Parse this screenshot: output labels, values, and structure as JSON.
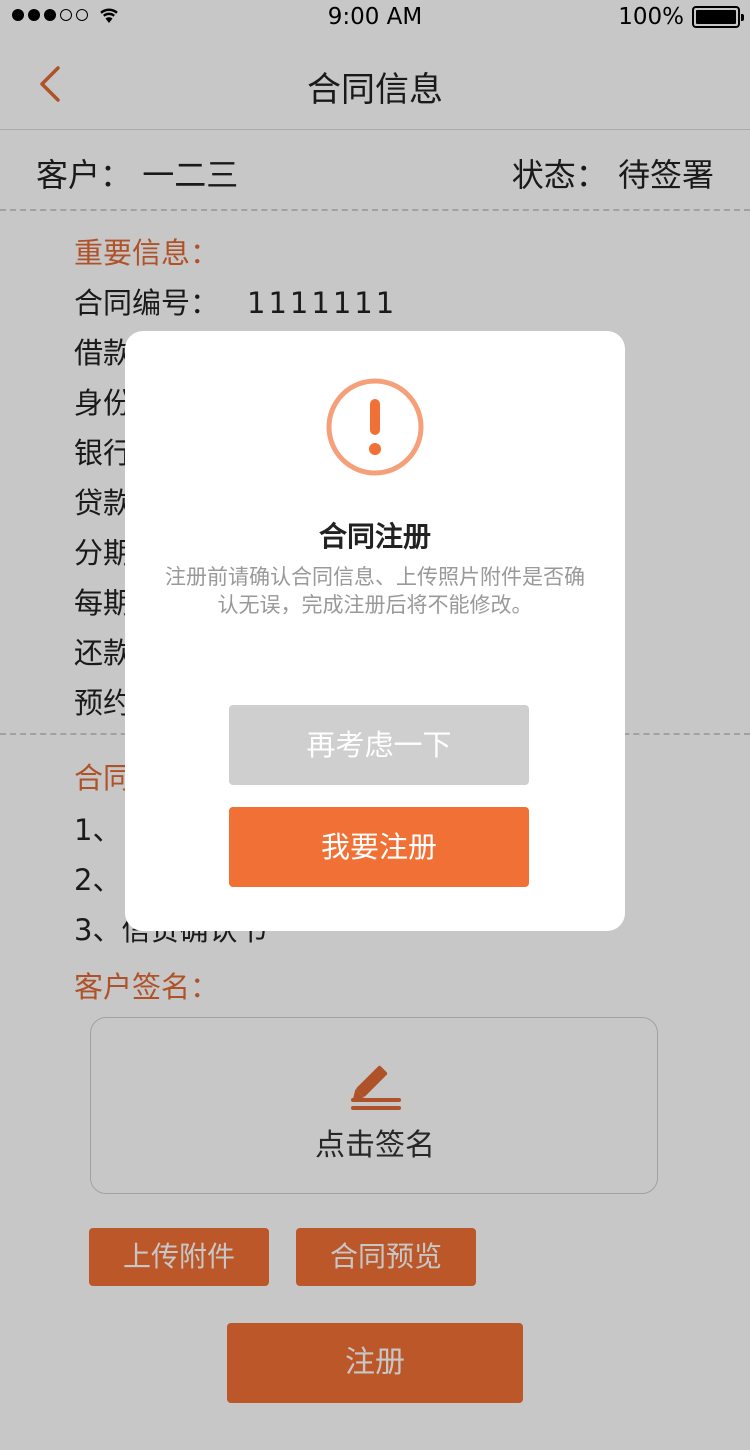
{
  "status_bar": {
    "time": "9:00 AM",
    "battery_percent": "100%",
    "battery_level": 1.0
  },
  "nav": {
    "title": "合同信息",
    "back_icon": "chevron-left-icon"
  },
  "header": {
    "customer_label": "客户：",
    "customer_name": "一二三",
    "status_label": "状态：",
    "status_value": "待签署"
  },
  "important_info": {
    "title": "重要信息：",
    "lines": [
      {
        "label": "合同编号：",
        "value": "1111111"
      },
      {
        "label": "借款",
        "value": ""
      },
      {
        "label": "身份",
        "value": ""
      },
      {
        "label": "银行",
        "value": ""
      },
      {
        "label": "贷款",
        "value": ""
      },
      {
        "label": "分期",
        "value": ""
      },
      {
        "label": "每期",
        "value": ""
      },
      {
        "label": "还款",
        "value": ""
      },
      {
        "label": "预约",
        "value": ""
      }
    ]
  },
  "contract_section": {
    "title": "合同",
    "items": [
      "1、",
      "2、",
      "3、信贷确认书"
    ]
  },
  "signature": {
    "title": "客户签名：",
    "button_label": "点击签名",
    "icon": "pen-icon"
  },
  "actions": {
    "upload_label": "上传附件",
    "preview_label": "合同预览",
    "register_label": "注册"
  },
  "modal": {
    "icon": "alert-icon",
    "title": "合同注册",
    "message": "注册前请确认合同信息、上传照片附件是否确认无误，完成注册后将不能修改。",
    "cancel_label": "再考虑一下",
    "confirm_label": "我要注册"
  },
  "colors": {
    "accent": "#f07035",
    "accent_text": "#e06a35",
    "alert_ring": "#f5a07a",
    "disabled_button": "#cfcfcf"
  }
}
